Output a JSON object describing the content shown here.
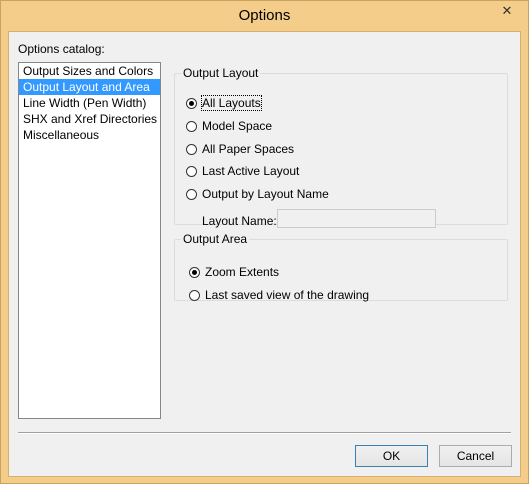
{
  "window": {
    "title": "Options",
    "close_glyph": "✕"
  },
  "catalog": {
    "label": "Options catalog:",
    "items": [
      {
        "label": "Output Sizes and Colors",
        "selected": false
      },
      {
        "label": "Output Layout and Area",
        "selected": true
      },
      {
        "label": "Line Width (Pen Width)",
        "selected": false
      },
      {
        "label": "SHX and Xref Directories",
        "selected": false
      },
      {
        "label": "Miscellaneous",
        "selected": false
      }
    ]
  },
  "output_layout": {
    "legend": "Output Layout",
    "options": [
      {
        "label": "All Layouts",
        "checked": true
      },
      {
        "label": "Model Space",
        "checked": false
      },
      {
        "label": "All Paper Spaces",
        "checked": false
      },
      {
        "label": "Last Active Layout",
        "checked": false
      },
      {
        "label": "Output by Layout Name",
        "checked": false
      }
    ],
    "layout_name_label": "Layout Name:",
    "layout_name_value": ""
  },
  "output_area": {
    "legend": "Output Area",
    "options": [
      {
        "label": "Zoom Extents",
        "checked": true
      },
      {
        "label": "Last saved view of the drawing",
        "checked": false
      }
    ]
  },
  "buttons": {
    "ok": "OK",
    "cancel": "Cancel"
  }
}
